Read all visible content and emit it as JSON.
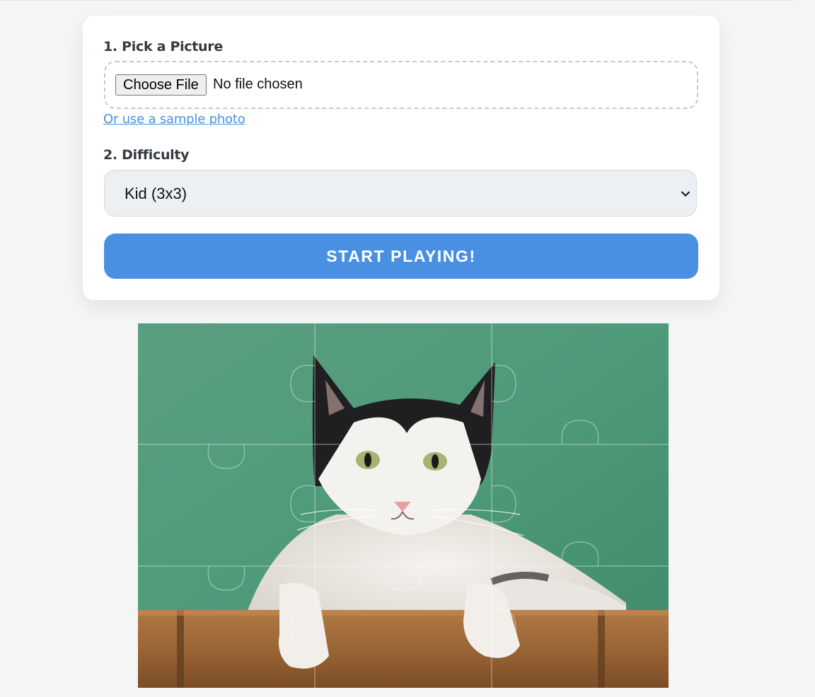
{
  "setup": {
    "pick_label": "1. Pick a Picture",
    "file_button_label": "Choose File",
    "file_status": "No file chosen",
    "sample_link": "Or use a sample photo",
    "difficulty_label": "2. Difficulty",
    "difficulty_value": "Kid (3x3)",
    "start_label": "START PLAYING!"
  },
  "preview": {
    "rows": 3,
    "cols": 3
  },
  "colors": {
    "accent": "#4a90e2",
    "page_bg": "#f4f5f5"
  }
}
